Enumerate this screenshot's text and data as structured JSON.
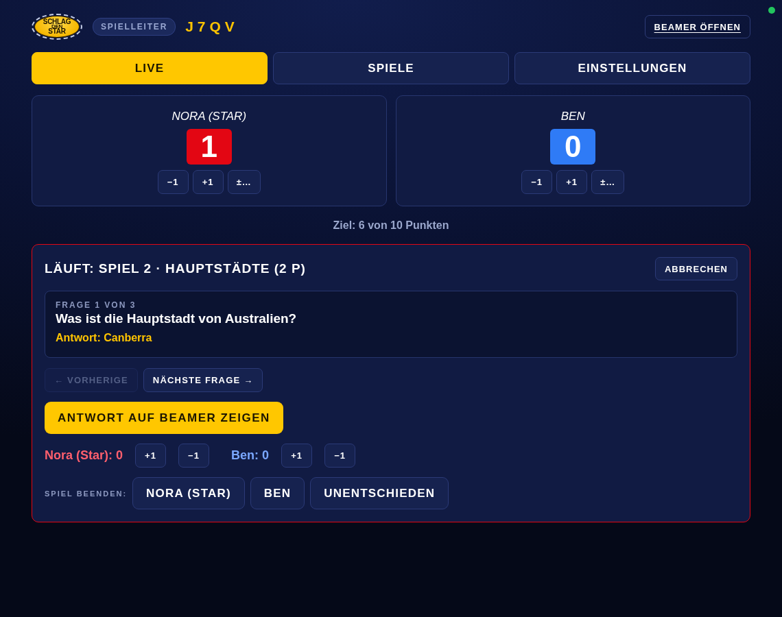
{
  "header": {
    "logo_lines": [
      "SCHLAG",
      "DEN",
      "STAR"
    ],
    "role_badge": "SPIELLEITER",
    "room_code": "J7QV",
    "beamer_button": "BEAMER ÖFFNEN",
    "connected": true
  },
  "tabs": [
    {
      "label": "LIVE",
      "selected": true
    },
    {
      "label": "SPIELE",
      "selected": false
    },
    {
      "label": "EINSTELLUNGEN",
      "selected": false
    }
  ],
  "players": [
    {
      "name": "NORA (STAR)",
      "score": "1",
      "color": "#e30613",
      "buttons": [
        "−1",
        "+1",
        "±…"
      ]
    },
    {
      "name": "BEN",
      "score": "0",
      "color": "#2f7bf6",
      "buttons": [
        "−1",
        "+1",
        "±…"
      ]
    }
  ],
  "goal": "Ziel: 6 von 10 Punkten",
  "game": {
    "title": "LÄUFT: SPIEL 2 · HAUPTSTÄDTE (2 P)",
    "cancel_button": "ABBRECHEN",
    "question": {
      "counter": "FRAGE 1 VON 3",
      "text": "Was ist die Hauptstadt von Australien?",
      "answer": "Antwort: Canberra"
    },
    "nav": [
      {
        "label": "← VORHERIGE",
        "disabled": true
      },
      {
        "label": "NÄCHSTE FRAGE →",
        "disabled": false
      }
    ],
    "reveal_button": "ANTWORT AUF BEAMER ZEIGEN",
    "round_scores": [
      {
        "label": "Nora (Star): 0",
        "color": "#ff5f6d",
        "buttons": [
          "+1",
          "−1"
        ]
      },
      {
        "label": "Ben: 0",
        "color": "#7aa7ff",
        "buttons": [
          "+1",
          "−1"
        ]
      }
    ],
    "end_label": "SPIEL BEENDEN:",
    "end_buttons": [
      "NORA (STAR)",
      "BEN",
      "UNENTSCHIEDEN"
    ]
  }
}
